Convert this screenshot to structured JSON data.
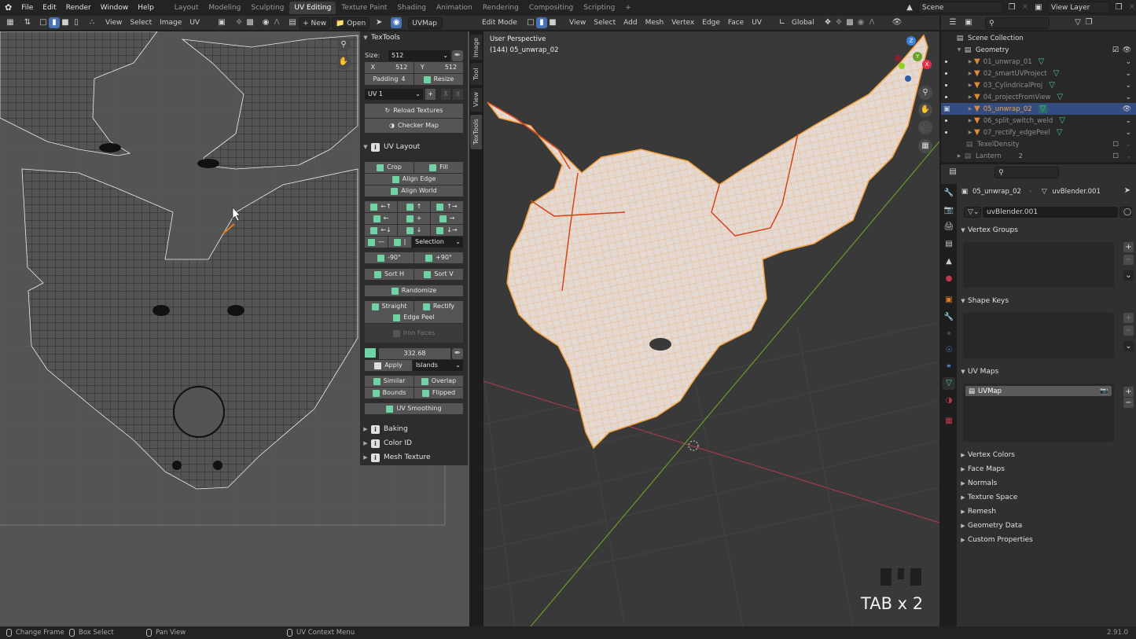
{
  "app": {
    "version": "2.91.0"
  },
  "topbar": {
    "menus": [
      "File",
      "Edit",
      "Render",
      "Window",
      "Help"
    ],
    "workspaces": [
      "Layout",
      "Modeling",
      "Sculpting",
      "UV Editing",
      "Texture Paint",
      "Shading",
      "Animation",
      "Rendering",
      "Compositing",
      "Scripting"
    ],
    "active_workspace": "UV Editing",
    "scene": "Scene",
    "view_layer": "View Layer"
  },
  "uv_header": {
    "menus": [
      "View",
      "Select",
      "Image",
      "UV"
    ],
    "new_label": "New",
    "open_label": "Open",
    "uvmap_label": "UVMap"
  },
  "vp_header": {
    "mode": "Edit Mode",
    "menus": [
      "View",
      "Select",
      "Add",
      "Mesh",
      "Vertex",
      "Edge",
      "Face",
      "UV"
    ],
    "orientation": "Global"
  },
  "uv_sidebar_tabs": [
    "Image",
    "Tool",
    "View",
    "TexTools"
  ],
  "active_sidebar_tab": "TexTools",
  "texTools": {
    "title": "TexTools",
    "size_label": "Size:",
    "size_value": "512",
    "x_label": "X",
    "x_value": "512",
    "y_label": "Y",
    "y_value": "512",
    "padding_label": "Padding",
    "padding_value": "4",
    "resize_label": "Resize",
    "uv_channel": "UV 1",
    "reload_textures": "Reload Textures",
    "checker_map": "Checker Map",
    "uv_layout": {
      "title": "UV Layout",
      "crop": "Crop",
      "fill": "Fill",
      "align_edge": "Align Edge",
      "align_world": "Align World",
      "align_grid": [
        [
          "←↑",
          "↑",
          "↑→"
        ],
        [
          "←",
          "+",
          "→"
        ],
        [
          "←↓",
          "↓",
          "↓→"
        ]
      ],
      "selection_dropdown": "Selection",
      "rot_neg": "-90°",
      "rot_pos": "+90°",
      "sort_h": "Sort H",
      "sort_v": "Sort V",
      "randomize": "Randomize",
      "straight": "Straight",
      "rectify": "Rectify",
      "edge_peel": "Edge Peel",
      "iron_faces": "Iron Faces",
      "texel_value": "332.68",
      "apply": "Apply",
      "islands_dropdown": "Islands",
      "similar": "Similar",
      "overlap": "Overlap",
      "bounds": "Bounds",
      "flipped": "Flipped",
      "uv_smoothing": "UV Smoothing"
    },
    "collapsed_panels": [
      "Baking",
      "Color ID",
      "Mesh Texture"
    ]
  },
  "viewport": {
    "perspective": "User Perspective",
    "object_info": "(144) 05_unwrap_02",
    "key_overlay": "TAB x 2",
    "gizmo_axes": [
      "X",
      "Y",
      "Z"
    ]
  },
  "outliner": {
    "root": "Scene Collection",
    "collection": "Geometry",
    "objects": [
      {
        "name": "01_unwrap_01",
        "selected": false
      },
      {
        "name": "02_smartUVProject",
        "selected": false
      },
      {
        "name": "03_CylindricalProj",
        "selected": false
      },
      {
        "name": "04_projectFromView",
        "selected": false
      },
      {
        "name": "05_unwrap_02",
        "selected": true
      },
      {
        "name": "06_split_switch_weld",
        "selected": false
      },
      {
        "name": "07_rectify_edgePeel",
        "selected": false
      }
    ],
    "other_collections": [
      {
        "name": "TexelDensity"
      },
      {
        "name": "Lantern",
        "badge": "2"
      }
    ]
  },
  "properties": {
    "object_name": "05_unwrap_02",
    "mesh_name": "uvBlender.001",
    "datablock": "uvBlender.001",
    "sections_open": [
      "Vertex Groups",
      "Shape Keys",
      "UV Maps"
    ],
    "uv_maps": [
      "UVMap"
    ],
    "sections_closed": [
      "Vertex Colors",
      "Face Maps",
      "Normals",
      "Texture Space",
      "Remesh",
      "Geometry Data",
      "Custom Properties"
    ]
  },
  "status_bar": {
    "items": [
      "Change Frame",
      "Box Select",
      "Pan View",
      "UV Context Menu"
    ],
    "version": "2.91.0"
  },
  "colors": {
    "accent_blue": "#4772b3",
    "texTools_green": "#6fd3a3",
    "selection_orange": "#f0a03c",
    "seam_red": "#d6461e"
  }
}
